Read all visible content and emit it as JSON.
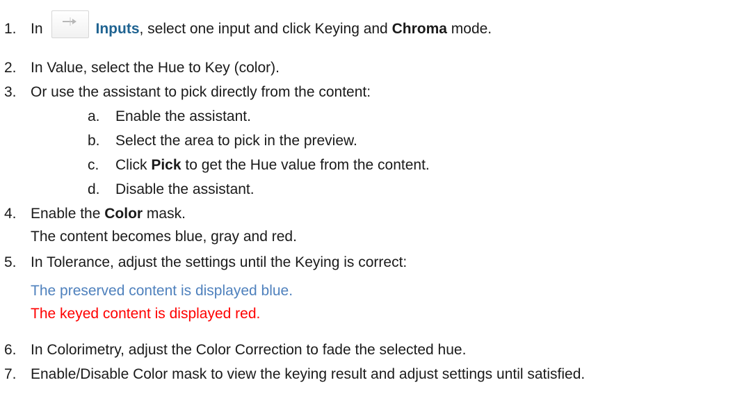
{
  "steps": [
    {
      "number": "1.",
      "pre": "In",
      "icon": "input-arrow-icon",
      "link": "Inputs",
      "mid": ", select one input and click Keying and ",
      "bold": "Chroma",
      "post": " mode."
    },
    {
      "number": "2.",
      "text": "In Value, select the Hue to Key (color)."
    },
    {
      "number": "3.",
      "text": "Or use the assistant to pick directly from the content:",
      "substeps": [
        {
          "letter": "a.",
          "text": "Enable the assistant."
        },
        {
          "letter": "b.",
          "text": "Select the area to pick in the preview."
        },
        {
          "letter": "c.",
          "pre": "Click ",
          "bold": "Pick",
          "post": " to get the Hue value from the content."
        },
        {
          "letter": "d.",
          "text": "Disable the assistant."
        }
      ]
    },
    {
      "number": "4.",
      "pre": "Enable the ",
      "bold": "Color",
      "post": " mask.",
      "note": "The content becomes blue, gray and red."
    },
    {
      "number": "5.",
      "text": "In Tolerance, adjust the settings until the Keying is correct:",
      "note_blue": "The preserved content is displayed blue.",
      "note_red": "The keyed content is displayed red."
    },
    {
      "number": "6.",
      "text": "In Colorimetry, adjust the Color Correction to fade the selected hue."
    },
    {
      "number": "7.",
      "text": "Enable/Disable Color mask to view the keying result and adjust settings until satisfied."
    }
  ],
  "colors": {
    "link": "#1f6391",
    "preserved_note": "#4f81bd",
    "keyed_note": "#ff0000"
  }
}
